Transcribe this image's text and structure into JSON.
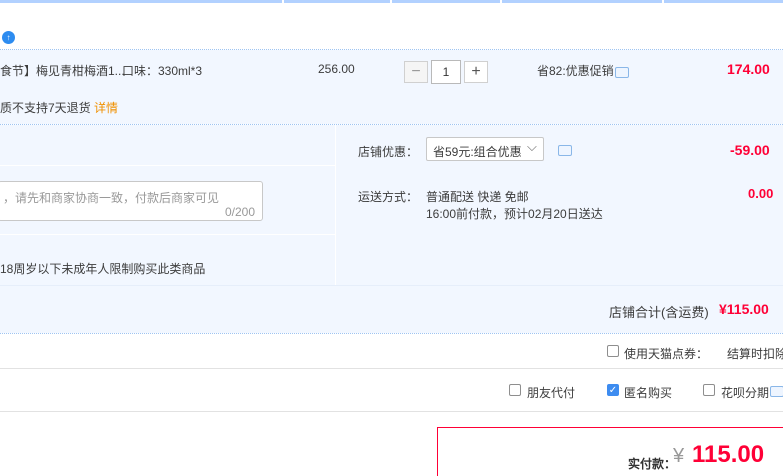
{
  "item": {
    "title": "食节】梅见青柑梅酒1...",
    "flavor": "口味：330ml*3",
    "unit_price": "256.00",
    "quantity": "1",
    "promo": "省82:优惠促销",
    "subtotal": "174.00",
    "return_notice": "质不支持7天退货",
    "details_link": "详情"
  },
  "shop": {
    "discount_label": "店铺优惠：",
    "discount_option": "省59元:组合优惠",
    "discount_amount": "-59.00",
    "shipping_label": "运送方式：",
    "shipping_method": "普通配送 快递 免邮",
    "shipping_eta": "16:00前付款，预计02月20日送达",
    "shipping_fee": "0.00",
    "message_placeholder": "，请先和商家协商一致，付款后商家可见",
    "message_counter": "0/200",
    "age_notice": "18周岁以下未成年人限制购买此类商品",
    "total_label": "店铺合计(含运费)",
    "total_value": "¥115.00"
  },
  "coupons": {
    "tmall_label": "使用天猫点券：",
    "tmall_status": "结算时扣除"
  },
  "options": {
    "friend_pay": "朋友代付",
    "anonymous": "匿名购买",
    "huabei": "花呗分期"
  },
  "pay": {
    "label": "实付款：",
    "currency": "¥",
    "amount": "115.00"
  },
  "colors": {
    "accent": "#ff0036",
    "link": "#f09000",
    "panel": "#f2f7ff"
  }
}
